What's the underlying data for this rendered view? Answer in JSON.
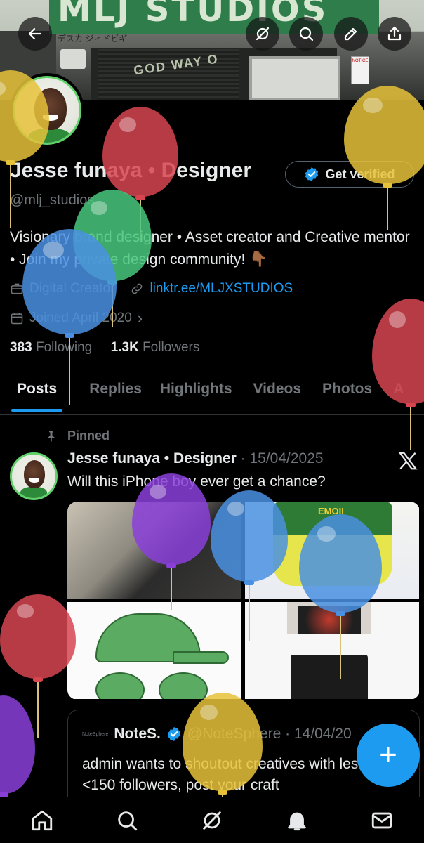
{
  "banner": {
    "sign_text": "MLJ STUDIOS",
    "jp_text": "デスカ ジィドビギ",
    "wall_text": "GOD WAY O",
    "notice_text": "NOTICE"
  },
  "header": {
    "back_icon": "arrow-left-icon",
    "actions": [
      "grok-icon",
      "search-icon",
      "edit-icon",
      "share-icon"
    ]
  },
  "profile": {
    "name": "Jesse funaya • Designer",
    "handle": "@mlj_studios",
    "verify_label": "Get verified",
    "bio": "Visionary brand designer • Asset creator and Creative mentor • Join my private design community! 👇🏾",
    "category": "Digital Creator",
    "link": "linktr.ee/MLJXSTUDIOS",
    "joined": "Joined April 2020",
    "following_count": "383",
    "following_label": "Following",
    "followers_count": "1.3K",
    "followers_label": "Followers"
  },
  "tabs": [
    {
      "label": "Posts",
      "active": true
    },
    {
      "label": "Replies"
    },
    {
      "label": "Highlights"
    },
    {
      "label": "Videos"
    },
    {
      "label": "Photos"
    },
    {
      "label": "A"
    }
  ],
  "post": {
    "pinned_label": "Pinned",
    "author": "Jesse funaya • Designer",
    "date": "· 15/04/2025",
    "text": "Will this iPhone boy ever get a chance?",
    "media_labels": {
      "jersey": "EMOII"
    },
    "quote": {
      "logo_text": "NoteSphere",
      "author": "NoteS.",
      "handle_date": "@NoteSphere · 14/04/20",
      "text": "admin wants to shoutout creatives with less than <150 followers, post your craft"
    }
  },
  "fab": {
    "label": "+"
  },
  "bottom_nav": [
    "home-icon",
    "search-icon",
    "grok-icon",
    "notifications-icon",
    "messages-icon"
  ],
  "colors": {
    "accent": "#1d9bf0",
    "verified_ring": "#5fd36a",
    "muted": "#71767b",
    "text": "#e7e9ea"
  }
}
